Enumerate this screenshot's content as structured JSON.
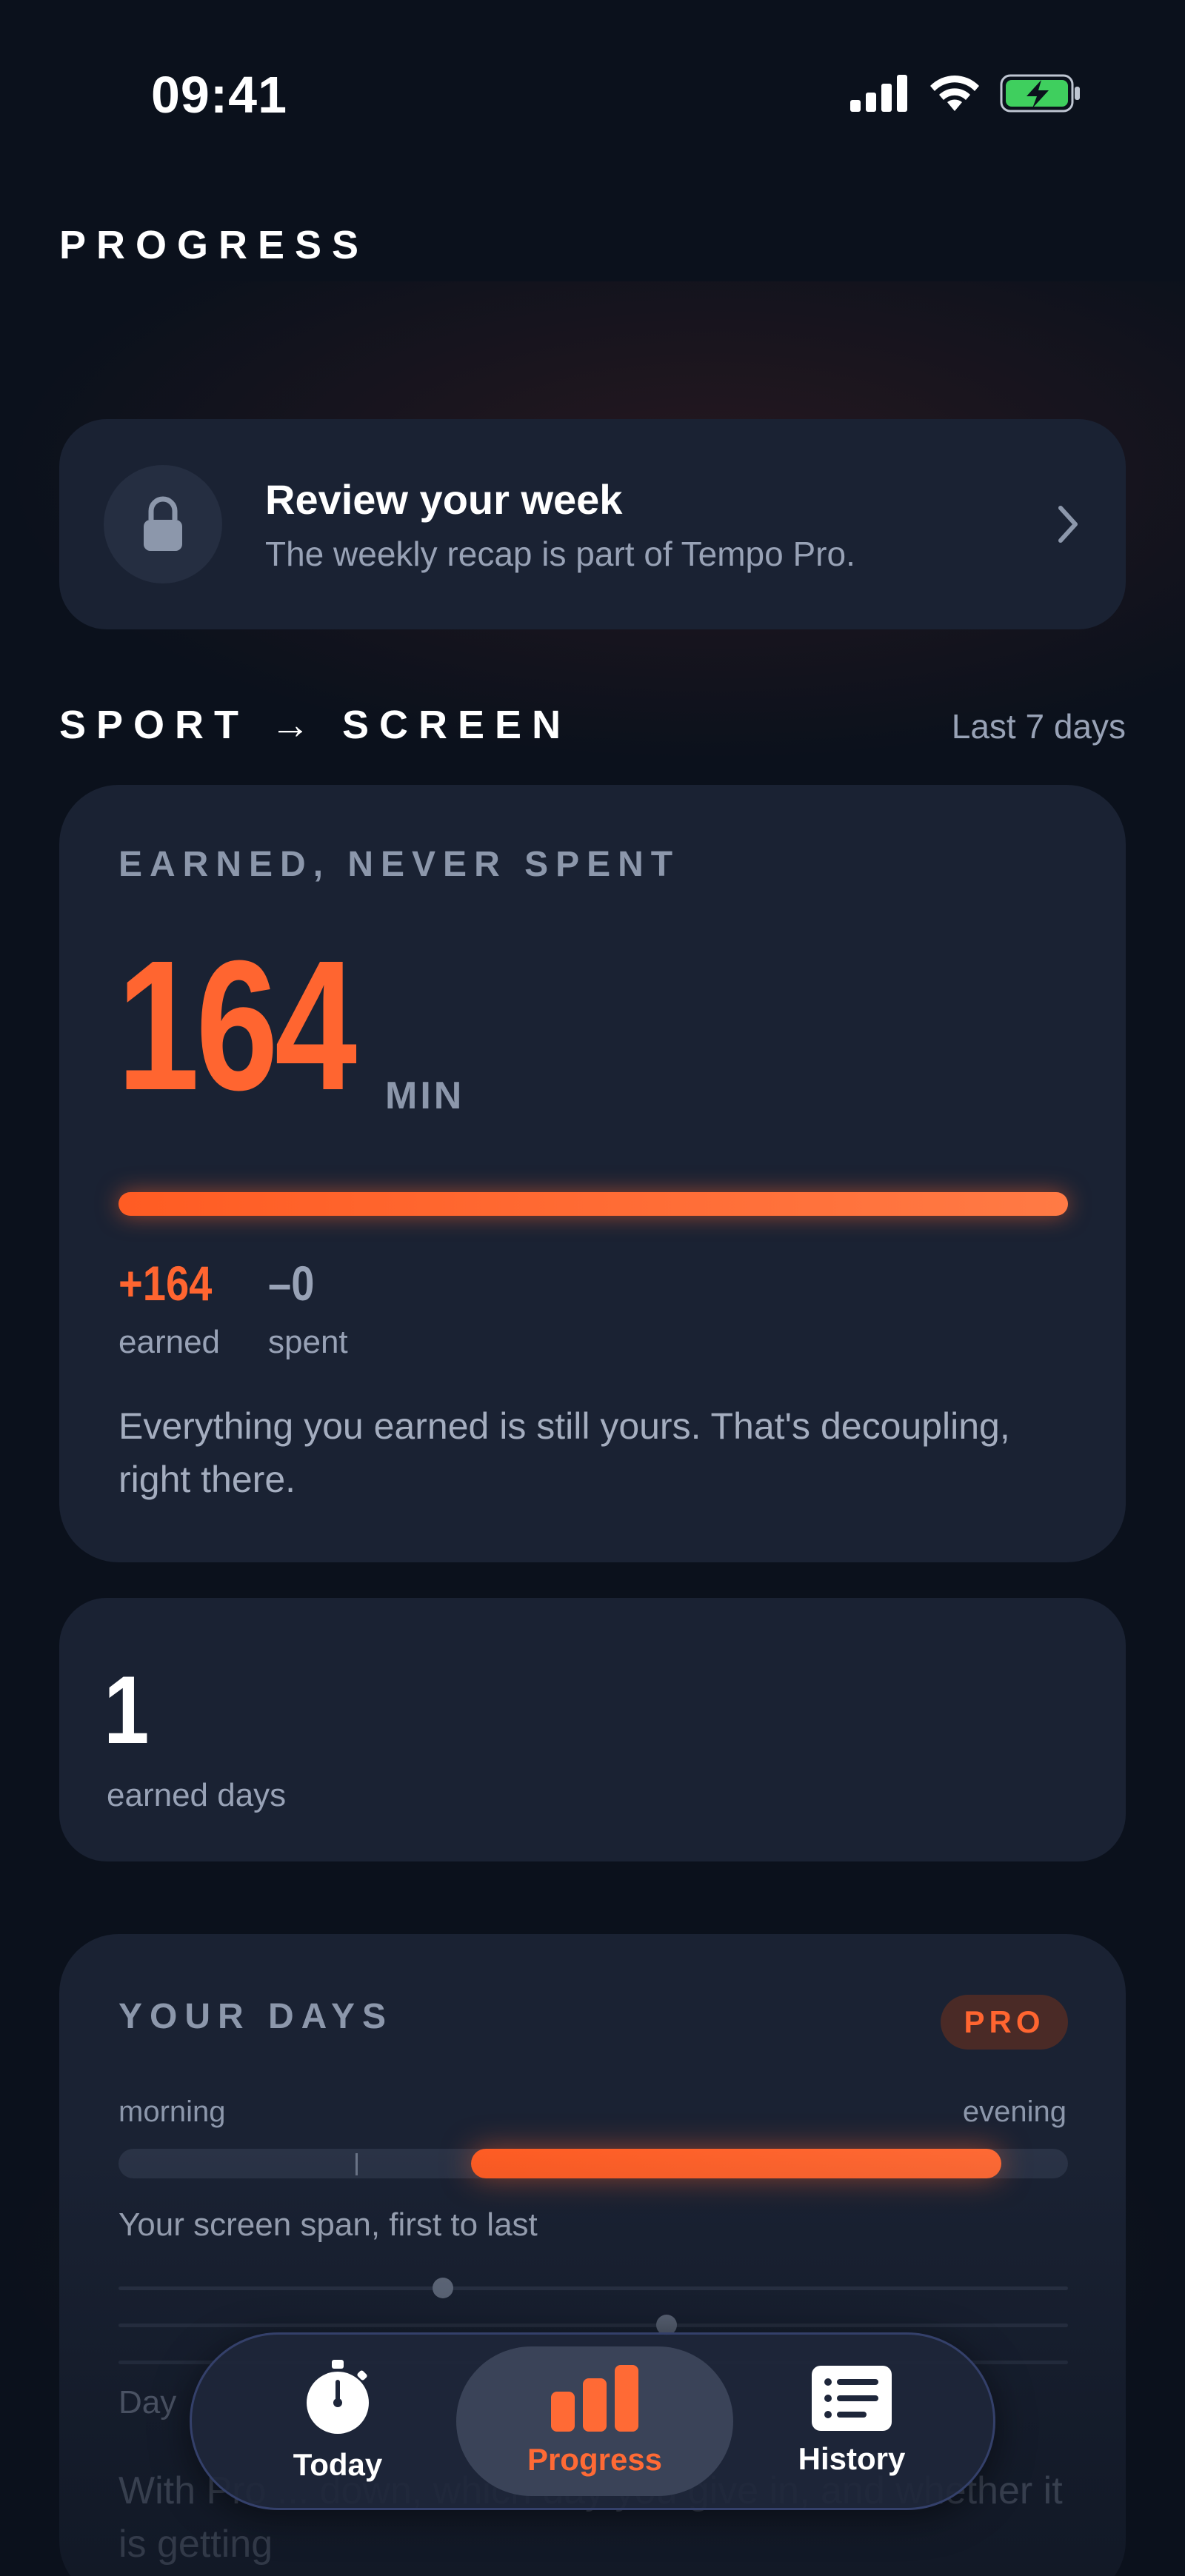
{
  "status_bar": {
    "time": "09:41"
  },
  "page": {
    "title": "PROGRESS"
  },
  "review_card": {
    "title": "Review your week",
    "subtitle": "The weekly recap is part of Tempo Pro.",
    "icon": "lock-icon"
  },
  "sport_screen": {
    "label": "SPORT → SCREEN",
    "range": "Last 7 days",
    "earned_card": {
      "label": "EARNED, NEVER SPENT",
      "total": "164",
      "unit": "MIN",
      "earned_fraction": 1.0,
      "earned_value": "+164",
      "earned_label": "earned",
      "spent_value": "–0",
      "spent_label": "spent",
      "message": "Everything you earned is still yours. That's decoupling, right there."
    },
    "days_card": {
      "value": "1",
      "label": "earned days"
    }
  },
  "your_days": {
    "title": "YOUR DAYS",
    "badge": "PRO",
    "morning_label": "morning",
    "evening_label": "evening",
    "span_caption": "Your screen span, first to last",
    "day_label": "Day",
    "body": "With Pro ... down, which day you give in, and whether it is getting"
  },
  "tabbar": {
    "tabs": [
      {
        "label": "Today",
        "icon": "stopwatch-icon"
      },
      {
        "label": "Progress",
        "icon": "bar-chart-icon",
        "active": true
      },
      {
        "label": "History",
        "icon": "list-icon"
      }
    ]
  },
  "colors": {
    "accent": "#ff6530",
    "card": "#1a2233",
    "background": "#0b111c"
  }
}
